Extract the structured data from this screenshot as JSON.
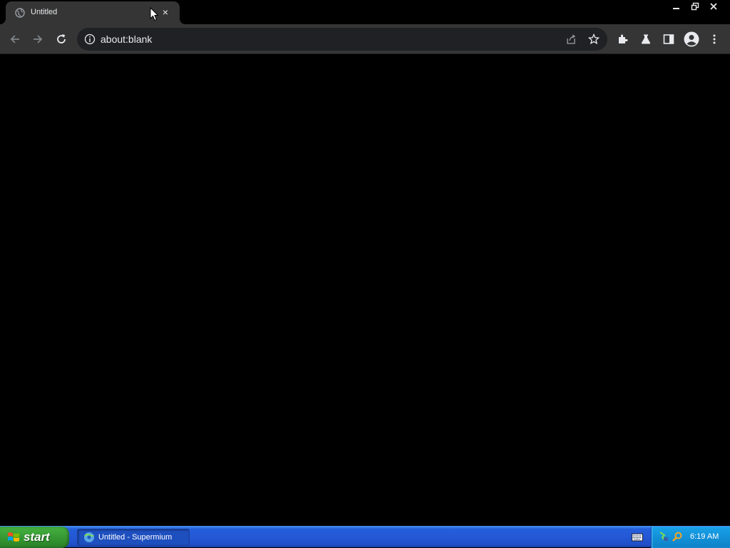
{
  "browser": {
    "tab": {
      "title": "Untitled",
      "close": "×"
    },
    "window_controls": [
      "minimize-icon",
      "restore-icon",
      "close-icon"
    ],
    "toolbar": {
      "address": "about:blank",
      "buttons": [
        "back-icon",
        "forward-icon",
        "reload-icon"
      ],
      "omnibox_icons": [
        "info-icon",
        "share-icon",
        "star-icon"
      ],
      "extension_icons": [
        "puzzle-icon",
        "flask-icon",
        "side-panel-icon",
        "profile-icon",
        "kebab-menu-icon"
      ]
    },
    "content": {
      "background": "#000000"
    }
  },
  "taskbar": {
    "start_label": "start",
    "items": [
      {
        "label": "Untitled - Supermium",
        "icon": "supermium-icon"
      }
    ],
    "tray": {
      "clock": "6:19 AM",
      "icons": [
        "keyboard-icon",
        "network-icon",
        "search-icon"
      ]
    }
  },
  "colors": {
    "toolbar": "#353535",
    "omnibox": "#202124",
    "taskbar": "#245edb",
    "start": "#3a9e37",
    "tray": "#1290d8"
  }
}
